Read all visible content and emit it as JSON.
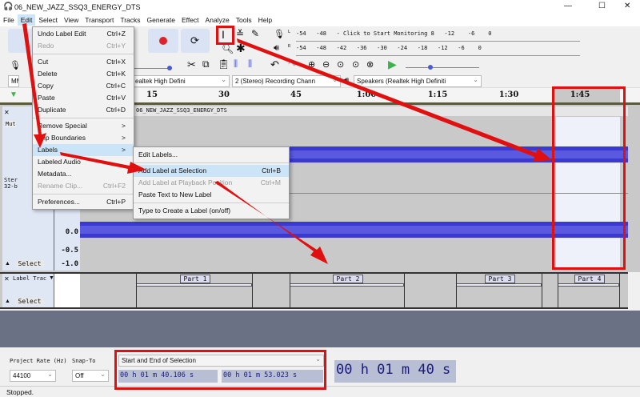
{
  "window": {
    "title": "06_NEW_JAZZ_SSQ3_ENERGY_DTS",
    "minimize": "—",
    "maximize": "☐",
    "close": "✕"
  },
  "menubar": [
    "File",
    "Edit",
    "Select",
    "View",
    "Transport",
    "Tracks",
    "Generate",
    "Effect",
    "Analyze",
    "Tools",
    "Help"
  ],
  "meters": {
    "record_scale": "-54   -48   - Click to Start Monitoring 8   -12    -6    0",
    "play_scale": "-54   -48   -42   -36   -30   -24   -18   -12   -6    0",
    "L": "L",
    "R": "R"
  },
  "devices": {
    "host": "MM",
    "recording_device": "ealtek High Defini",
    "channels": "2 (Stereo) Recording Chann",
    "playback_device": "Speakers (Realtek High Definiti"
  },
  "ruler": {
    "ticks": [
      "15",
      "30",
      "45",
      "1:00",
      "1:15",
      "1:30",
      "1:45"
    ]
  },
  "audio_track": {
    "name": "06_NEW_JAZZ_SSQ3_ENERGY_DTS",
    "mute": "Mut",
    "info": "Ster\n32-b",
    "scale": [
      "0.0",
      "-0.5",
      "-1.0"
    ],
    "select": "Select"
  },
  "label_track": {
    "name": "Label Trac",
    "select": "Select",
    "labels": [
      "Part 1",
      "Part 2",
      "Part 3",
      "Part 4"
    ]
  },
  "edit_menu": {
    "items": [
      {
        "label": "Undo Label Edit",
        "shortcut": "Ctrl+Z"
      },
      {
        "label": "Redo",
        "shortcut": "Ctrl+Y",
        "disabled": true
      },
      {
        "label": "Cut",
        "shortcut": "Ctrl+X"
      },
      {
        "label": "Delete",
        "shortcut": "Ctrl+K"
      },
      {
        "label": "Copy",
        "shortcut": "Ctrl+C"
      },
      {
        "label": "Paste",
        "shortcut": "Ctrl+V"
      },
      {
        "label": "Duplicate",
        "shortcut": "Ctrl+D"
      },
      {
        "label": "Remove Special",
        "shortcut": ">"
      },
      {
        "label": "Clip Boundaries",
        "shortcut": ">"
      },
      {
        "label": "Labels",
        "shortcut": ">"
      },
      {
        "label": "Labeled Audio",
        "shortcut": ""
      },
      {
        "label": "Metadata...",
        "shortcut": ""
      },
      {
        "label": "Rename Clip...",
        "shortcut": "Ctrl+F2",
        "disabled": true
      },
      {
        "label": "Preferences...",
        "shortcut": "Ctrl+P"
      }
    ]
  },
  "labels_submenu": {
    "items": [
      {
        "label": "Edit Labels...",
        "shortcut": ""
      },
      {
        "label": "Add Label at Selection",
        "shortcut": "Ctrl+B"
      },
      {
        "label": "Add Label at Playback Position",
        "shortcut": "Ctrl+M",
        "disabled": true
      },
      {
        "label": "Paste Text to New Label",
        "shortcut": ""
      },
      {
        "label": "Type to Create a Label (on/off)",
        "shortcut": ""
      }
    ]
  },
  "selection_toolbar": {
    "project_rate_label": "Project Rate (Hz)",
    "project_rate": "44100",
    "snap_label": "Snap-To",
    "snap": "Off",
    "mode": "Start and End of Selection",
    "start": "00 h 01 m 40.106 s",
    "end": "00 h 01 m 53.023 s",
    "audio_position": "00 h 01 m 40 s"
  },
  "status": "Stopped.",
  "colors": {
    "annotation_red": "#e01010",
    "waveform": "#3a3ad0",
    "selection": "#eef0fa"
  }
}
